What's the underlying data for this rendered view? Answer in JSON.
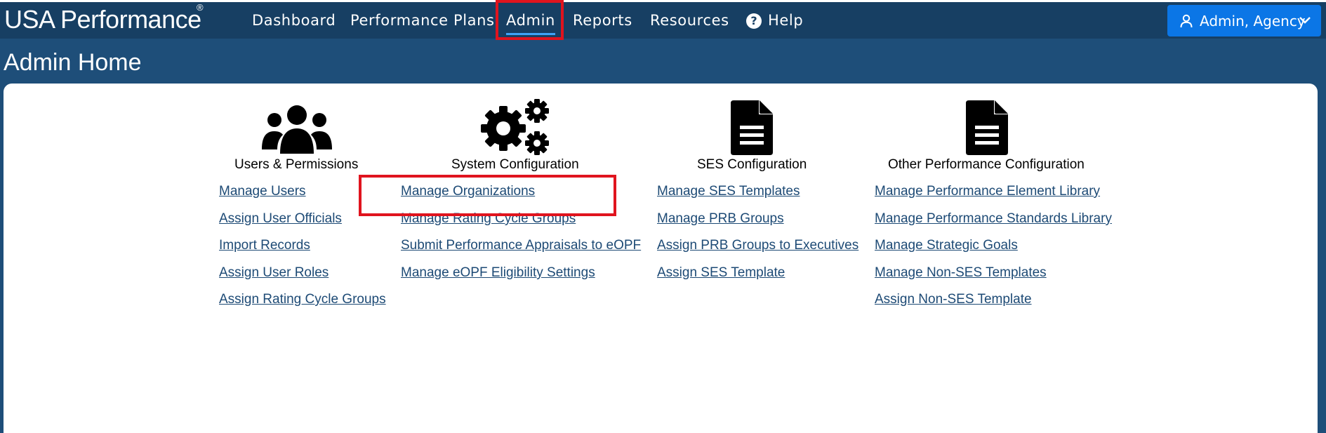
{
  "header": {
    "brand": "USA Performance",
    "brand_mark": "®",
    "nav": [
      {
        "label": "Dashboard"
      },
      {
        "label": "Performance Plans"
      },
      {
        "label": "Admin",
        "active": true
      },
      {
        "label": "Reports"
      },
      {
        "label": "Resources"
      },
      {
        "label": "Help",
        "icon": "question-circle-icon"
      }
    ],
    "user_menu": {
      "label": "Admin, Agency",
      "icon": "user-icon",
      "caret": "chevron-down-icon"
    }
  },
  "page_title": "Admin Home",
  "columns": [
    {
      "heading": "Users & Permissions",
      "icon": "users-group-icon",
      "links": [
        "Manage Users",
        "Assign User Officials",
        "Import Records",
        "Assign User Roles",
        "Assign Rating Cycle Groups"
      ]
    },
    {
      "heading": "System Configuration",
      "icon": "gears-icon",
      "links": [
        "Manage Organizations",
        "Manage Rating Cycle Groups",
        "Submit Performance Appraisals to eOPF",
        "Manage eOPF Eligibility Settings"
      ]
    },
    {
      "heading": "SES Configuration",
      "icon": "document-icon",
      "links": [
        "Manage SES Templates",
        "Manage PRB Groups",
        "Assign PRB Groups to Executives",
        "Assign SES Template"
      ]
    },
    {
      "heading": "Other Performance Configuration",
      "icon": "document-icon",
      "links": [
        "Manage Performance Element Library",
        "Manage Performance Standards Library",
        "Manage Strategic Goals",
        "Manage Non-SES Templates",
        "Assign Non-SES Template"
      ]
    }
  ],
  "colors": {
    "navbar": "#173f63",
    "page_bg": "#1e4e79",
    "user_button": "#0b76e6",
    "link": "#1d4a75",
    "highlight": "#e0141e"
  }
}
